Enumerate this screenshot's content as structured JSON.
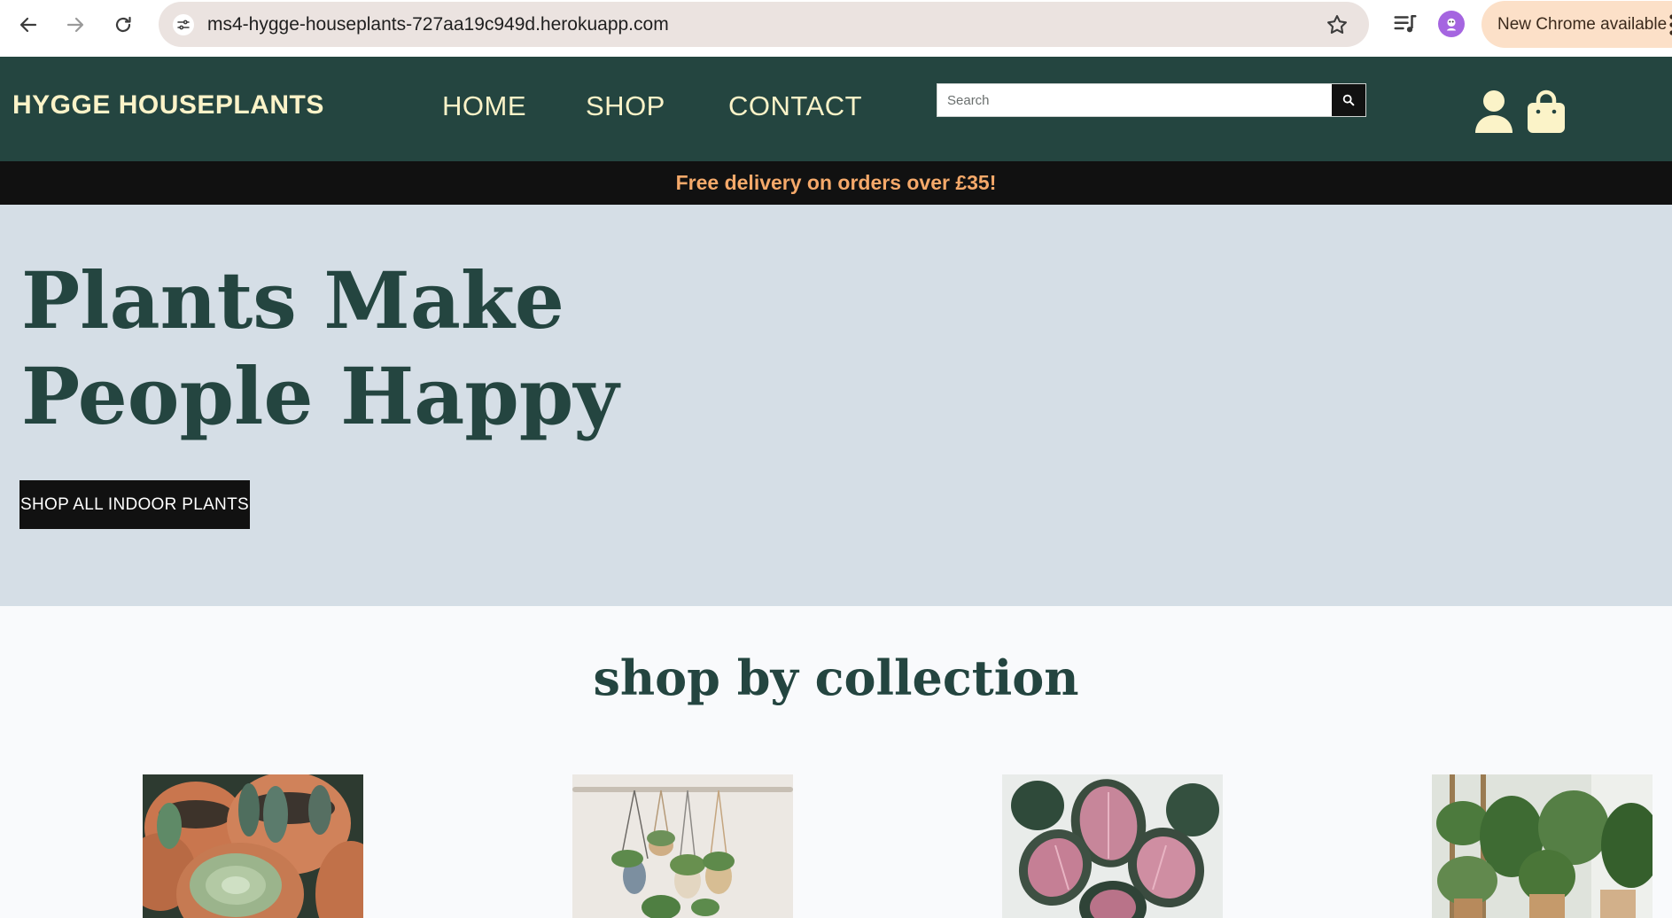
{
  "browser": {
    "url": "ms4-hygge-houseplants-727aa19c949d.herokuapp.com",
    "update_label": "New Chrome available",
    "icons": [
      "back-arrow-icon",
      "forward-arrow-icon",
      "reload-icon",
      "site-info-icon",
      "bookmark-star-icon",
      "media-queue-icon",
      "profile-avatar-icon",
      "menu-dots-icon"
    ]
  },
  "header": {
    "brand": "HYGGE HOUSEPLANTS",
    "nav": [
      "HOME",
      "SHOP",
      "CONTACT"
    ],
    "search_placeholder": "Search",
    "icons": [
      "search-icon",
      "account-icon",
      "shopping-bag-icon"
    ],
    "colors": {
      "background": "#244540",
      "accent": "#fbf3c8"
    }
  },
  "banner": {
    "text": "Free delivery on orders over £35!",
    "colors": {
      "background": "#111111",
      "text": "#f5a96a"
    }
  },
  "hero": {
    "headline": "Plants Make People Happy",
    "cta": "SHOP ALL INDOOR PLANTS",
    "colors": {
      "background": "#d5dee6",
      "headline": "#244540"
    }
  },
  "collections": {
    "title": "shop by collection",
    "images": [
      "cacti-and-succulents-image",
      "hanging-planters-image",
      "pink-leaf-plant-image",
      "large-indoor-plants-image"
    ]
  }
}
